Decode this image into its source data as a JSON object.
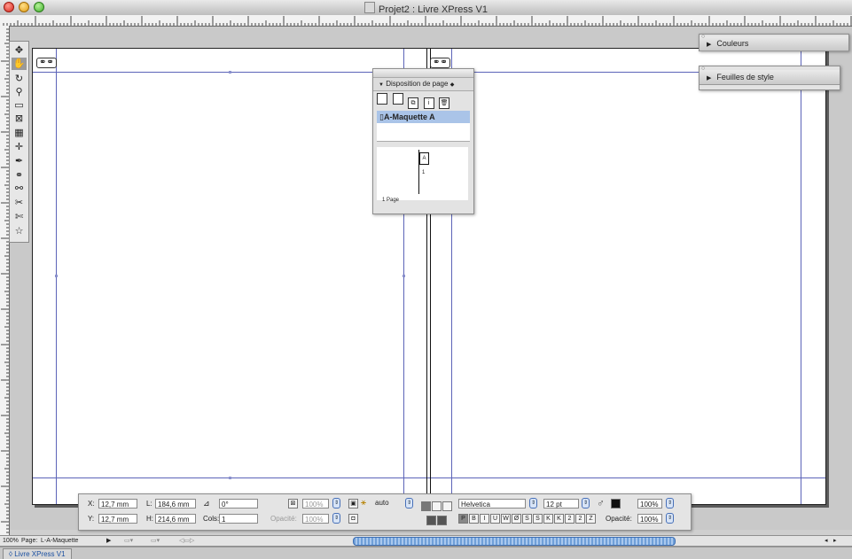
{
  "window": {
    "title": "Projet2 : Livre XPress V1"
  },
  "panels": {
    "colors": "Couleurs",
    "style_sheets": "Feuilles de style"
  },
  "page_layout_panel": {
    "title": "Disposition de page",
    "master": "A-Maquette A",
    "thumb_label": "A",
    "thumb_number": "1",
    "page_count": "1 Page"
  },
  "measurements": {
    "x_label": "X:",
    "x_value": "12,7 mm",
    "y_label": "Y:",
    "y_value": "12,7 mm",
    "w_label": "L:",
    "w_value": "184,6 mm",
    "h_label": "H:",
    "h_value": "214,6 mm",
    "angle_value": "0°",
    "cols_label": "Cols:",
    "cols_value": "1",
    "scale_value": "100%",
    "opacity_label": "Opacité:",
    "opacity_value_dim": "100%",
    "leading_value": "auto",
    "font_value": "Helvetica",
    "size_value": "12 pt",
    "shade_value": "100%",
    "opacity_label_right": "Opacité:",
    "opacity_value_right": "100%",
    "style_buttons": [
      "P",
      "B",
      "I",
      "U",
      "W",
      "Ø",
      "S",
      "S",
      "K",
      "K",
      "2",
      "2",
      "Z"
    ]
  },
  "statusbar": {
    "zoom": "100%",
    "page": "Page:",
    "page_value": "L-A-Maquette"
  },
  "tab": {
    "label": "Livre XPress V1"
  },
  "colors_ui": {
    "guide": "#5c64b8",
    "selection": "#aac4e8",
    "scroll": "#6f9fd8"
  }
}
